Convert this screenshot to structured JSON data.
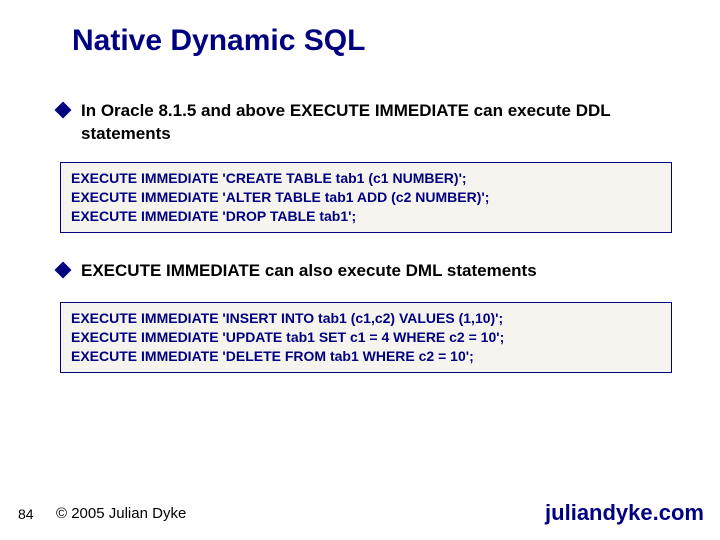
{
  "title": "Native Dynamic SQL",
  "bullets": {
    "b1": "In Oracle 8.1.5 and above EXECUTE IMMEDIATE can execute DDL statements",
    "b2": "EXECUTE IMMEDIATE can also execute DML statements"
  },
  "code1": {
    "l1": "EXECUTE IMMEDIATE 'CREATE TABLE tab1 (c1 NUMBER)';",
    "l2": "EXECUTE IMMEDIATE 'ALTER TABLE tab1 ADD (c2 NUMBER)';",
    "l3": "EXECUTE IMMEDIATE 'DROP TABLE tab1';"
  },
  "code2": {
    "l1": "EXECUTE IMMEDIATE 'INSERT INTO tab1 (c1,c2) VALUES (1,10)';",
    "l2": "EXECUTE IMMEDIATE 'UPDATE tab1 SET c1 = 4 WHERE c2 = 10';",
    "l3": "EXECUTE IMMEDIATE 'DELETE FROM tab1 WHERE c2 = 10';"
  },
  "footer": {
    "slide_number": "84",
    "copyright": "© 2005 Julian Dyke",
    "site": "juliandyke.com"
  }
}
